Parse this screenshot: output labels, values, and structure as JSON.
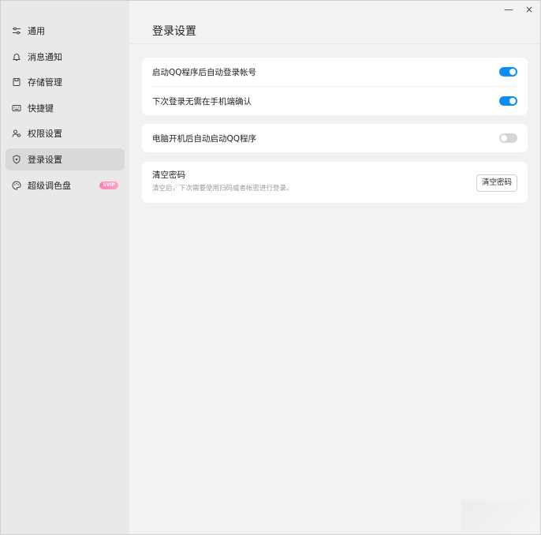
{
  "window_controls": {
    "minimize": "—",
    "close": "×"
  },
  "sidebar": {
    "items": [
      {
        "key": "general",
        "label": "通用",
        "icon": "sliders-icon"
      },
      {
        "key": "notify",
        "label": "消息通知",
        "icon": "bell-icon"
      },
      {
        "key": "storage",
        "label": "存储管理",
        "icon": "storage-icon"
      },
      {
        "key": "shortcut",
        "label": "快捷键",
        "icon": "keyboard-icon"
      },
      {
        "key": "permission",
        "label": "权限设置",
        "icon": "users-icon"
      },
      {
        "key": "login",
        "label": "登录设置",
        "icon": "shield-icon",
        "active": true
      },
      {
        "key": "palette",
        "label": "超级调色盘",
        "icon": "palette-icon",
        "badge": "SVIP"
      }
    ]
  },
  "main": {
    "title": "登录设置",
    "card1": {
      "rows": [
        {
          "label": "启动QQ程序后自动登录帐号",
          "toggle": "on"
        },
        {
          "label": "下次登录无需在手机端确认",
          "toggle": "on"
        }
      ]
    },
    "card2": {
      "rows": [
        {
          "label": "电脑开机后自动启动QQ程序",
          "toggle": "off"
        }
      ]
    },
    "password": {
      "title": "清空密码",
      "desc": "清空后，下次需要使用扫码或者帐密进行登录。",
      "button": "清空密码"
    }
  },
  "colors": {
    "accent": "#0b8df5",
    "toggle_off": "#d6d6d6",
    "sidebar_bg": "#e9e9e9",
    "content_bg": "#f2f2f2"
  }
}
